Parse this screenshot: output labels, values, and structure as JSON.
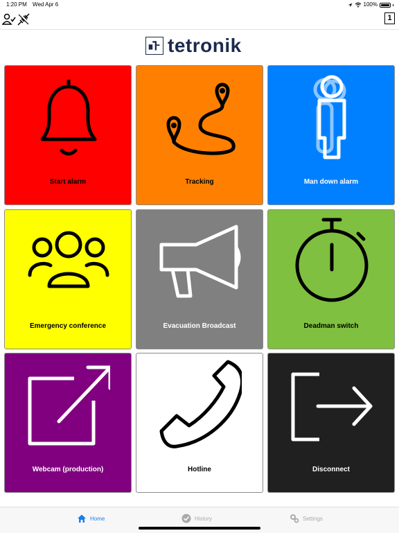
{
  "status_bar": {
    "time": "1:20 PM",
    "date": "Wed Apr 6",
    "battery": "100%"
  },
  "header": {
    "counter": "1"
  },
  "logo": {
    "text": "tetronik"
  },
  "tiles": [
    {
      "label": "Start alarm",
      "icon": "bell-icon",
      "color": "#ff0000",
      "text_color": "#000000"
    },
    {
      "label": "Tracking",
      "icon": "route-icon",
      "color": "#ff8000",
      "text_color": "#000000"
    },
    {
      "label": "Man down alarm",
      "icon": "man-down-icon",
      "color": "#0080ff",
      "text_color": "#ffffff"
    },
    {
      "label": "Emergency conference",
      "icon": "people-icon",
      "color": "#ffff00",
      "text_color": "#000000"
    },
    {
      "label": "Evacuation Broadcast",
      "icon": "megaphone-icon",
      "color": "#808080",
      "text_color": "#ffffff"
    },
    {
      "label": "Deadman switch",
      "icon": "stopwatch-icon",
      "color": "#80c040",
      "text_color": "#000000"
    },
    {
      "label": "Webcam (production)",
      "icon": "external-link-icon",
      "color": "#800080",
      "text_color": "#ffffff"
    },
    {
      "label": "Hotline",
      "icon": "phone-icon",
      "color": "#ffffff",
      "text_color": "#000000"
    },
    {
      "label": "Disconnect",
      "icon": "logout-icon",
      "color": "#202020",
      "text_color": "#ffffff"
    }
  ],
  "tab_bar": {
    "active_color": "#1a7ef0",
    "inactive_color": "#a9a9a9",
    "tabs": [
      {
        "label": "Home",
        "icon": "home-icon",
        "active": true
      },
      {
        "label": "History",
        "icon": "history-icon",
        "active": false
      },
      {
        "label": "Settings",
        "icon": "gear-icon",
        "active": false
      }
    ]
  }
}
